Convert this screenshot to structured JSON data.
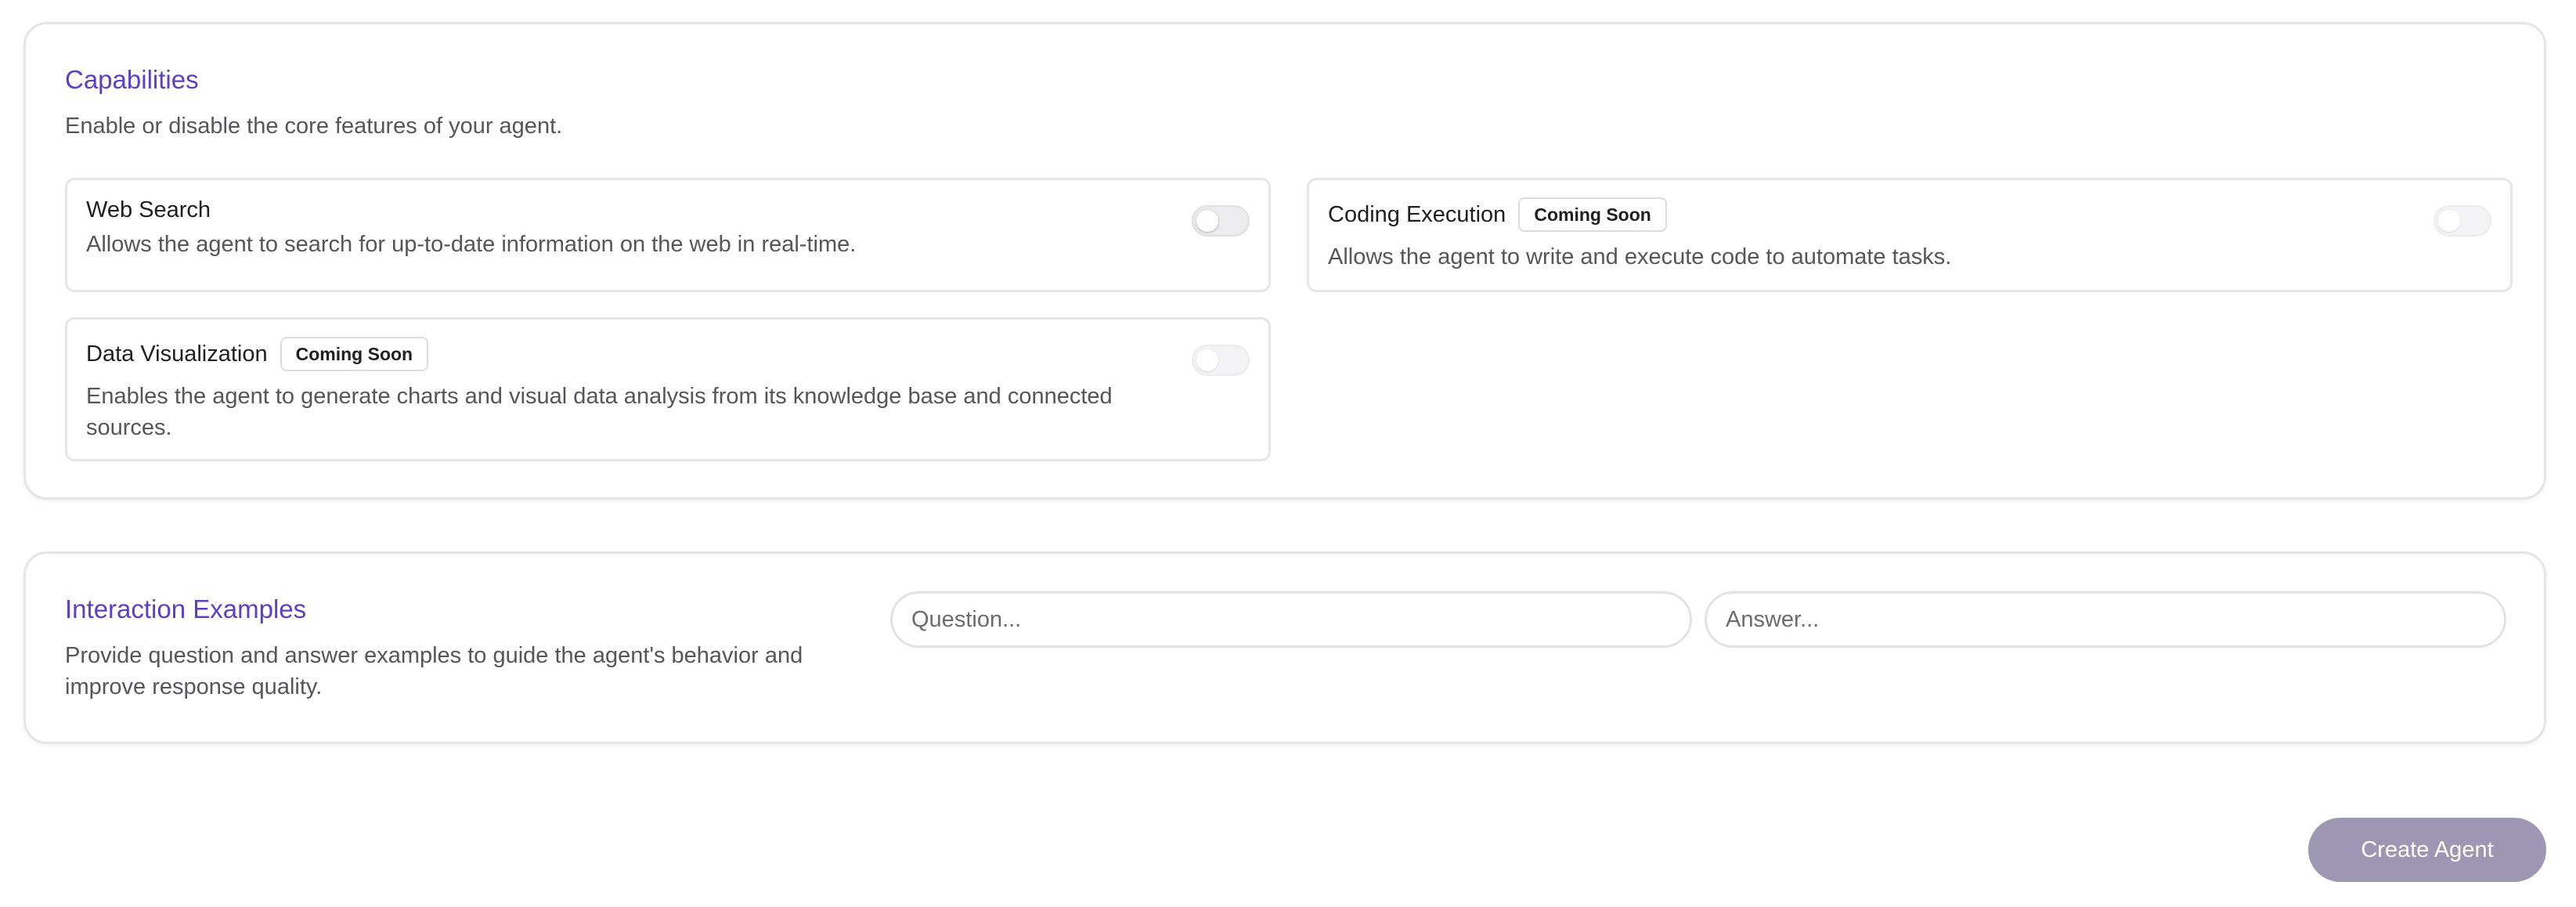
{
  "capabilities": {
    "title": "Capabilities",
    "description": "Enable or disable the core features of your agent.",
    "items": [
      {
        "title": "Web Search",
        "badge": "",
        "description": "Allows the agent to search for up-to-date information on the web in real-time.",
        "enabled": false
      },
      {
        "title": "Coding Execution",
        "badge": "Coming Soon",
        "description": "Allows the agent to write and execute code to automate tasks.",
        "enabled": false
      },
      {
        "title": "Data Visualization",
        "badge": "Coming Soon",
        "description": "Enables the agent to generate charts and visual data analysis from its knowledge base and connected sources.",
        "enabled": false
      }
    ]
  },
  "interaction_examples": {
    "title": "Interaction Examples",
    "description": "Provide question and answer examples to guide the agent's behavior and improve response quality.",
    "question_placeholder": "Question...",
    "answer_placeholder": "Answer..."
  },
  "actions": {
    "create_label": "Create Agent"
  },
  "colors": {
    "accent": "#5b3fc4",
    "button_disabled": "#9d97b3"
  }
}
